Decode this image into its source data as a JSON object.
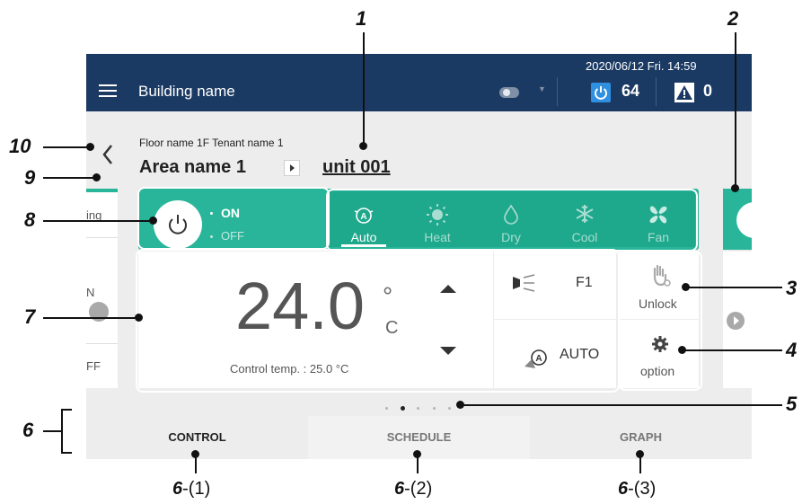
{
  "header": {
    "building_name": "Building name",
    "datetime": "2020/06/12 Fri. 14:59",
    "power_count": "64",
    "warning_count": "0"
  },
  "location": {
    "floor_tenant": "Floor name 1F Tenant name 1",
    "area": "Area name 1",
    "unit": "unit 001"
  },
  "left_card": {
    "line1": "ing",
    "line2": "N",
    "line3": "FF"
  },
  "power": {
    "on_label": "ON",
    "off_label": "OFF",
    "state": "on"
  },
  "modes": [
    {
      "label": "Auto",
      "icon": "auto-mode-icon",
      "active": true
    },
    {
      "label": "Heat",
      "icon": "sun-icon",
      "active": false
    },
    {
      "label": "Dry",
      "icon": "droplet-icon",
      "active": false
    },
    {
      "label": "Cool",
      "icon": "snowflake-icon",
      "active": false
    },
    {
      "label": "Fan",
      "icon": "fan-icon",
      "active": false
    }
  ],
  "temperature": {
    "setpoint": "24.0",
    "degree": "°",
    "unit": "C",
    "control_temp": "Control temp. : 25.0 °C"
  },
  "fan_speed": "F1",
  "louver": "AUTO",
  "lock": {
    "label": "Unlock"
  },
  "option": {
    "label": "option"
  },
  "pagination": {
    "pages": 5,
    "current": 2
  },
  "tabs": [
    {
      "label": "CONTROL",
      "active": true
    },
    {
      "label": "SCHEDULE",
      "active": false
    },
    {
      "label": "GRAPH",
      "active": false
    }
  ],
  "callouts": {
    "c1": "1",
    "c2": "2",
    "c3": "3",
    "c4": "4",
    "c5": "5",
    "c6": "6",
    "c7": "7",
    "c8": "8",
    "c9": "9",
    "c10": "10"
  },
  "footnotes": [
    {
      "num": "6",
      "sub": "-(1)"
    },
    {
      "num": "6",
      "sub": "-(2)"
    },
    {
      "num": "6",
      "sub": "-(3)"
    }
  ],
  "colors": {
    "header_bg": "#1b3a63",
    "accent_green": "#29b59a",
    "power_blue": "#2f8fe1",
    "screen_bg": "#ededed"
  }
}
